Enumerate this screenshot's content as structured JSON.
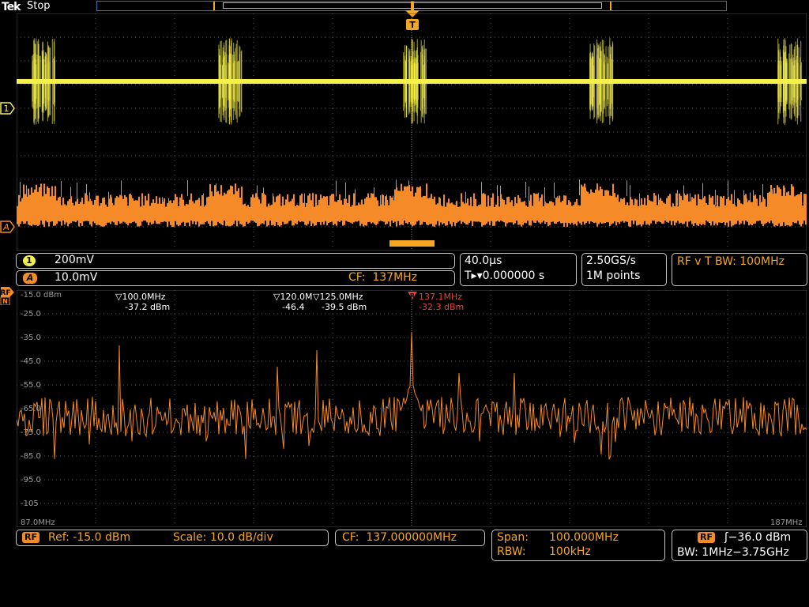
{
  "top": {
    "brand": "Tek",
    "run_state": "Stop",
    "trigger_marker": "T"
  },
  "channels": {
    "ch1_marker": "1",
    "chA_marker": "A",
    "rf_marker": "RF",
    "rf_sub": "N"
  },
  "readouts": {
    "ch1_badge": "1",
    "ch1_scale": "200mV",
    "chA_badge": "A",
    "chA_scale": "10.0mV",
    "chA_cf": "CF:  137MHz",
    "horiz_scale": "40.0µs",
    "trigger_pos": "T▸▾0.000000 s",
    "sample_rate": "2.50GS/s",
    "record_length": "1M points",
    "rf_v_t": "RF v T BW: 100MHz"
  },
  "spectrum": {
    "y_labels": [
      "-15.0 dBm",
      "-25.0",
      "-35.0",
      "-45.0",
      "-55.0",
      "-65.0",
      "-75.0",
      "-85.0",
      "-95.0",
      "-105"
    ],
    "x_start": "87.0MHz",
    "x_end": "187MHz",
    "markers": [
      {
        "freq": "▽100.0MHz",
        "level": "-37.2 dBm"
      },
      {
        "freq": "▽120.0M",
        "level": "-46.4"
      },
      {
        "freq": "▽125.0MHz",
        "level": "-39.5 dBm"
      },
      {
        "freq": "137.1MHz",
        "level": "-32.3 dBm",
        "ref": "R"
      }
    ]
  },
  "bottom": {
    "rf_badge": "RF",
    "ref": "Ref: -15.0 dBm",
    "scale": "Scale: 10.0 dB/div",
    "cf": "CF:  137.000000MHz",
    "span_label": "Span:",
    "span_value": "100.000MHz",
    "rbw_label": "RBW:",
    "rbw_value": "100kHz",
    "trig_badge": "RF",
    "trig_level": "ʃ−36.0 dBm",
    "bw": "BW: 1MHz−3.75GHz"
  },
  "colors": {
    "ch1": "#f5f04a",
    "rf": "#f58a29",
    "ref_marker": "#e0453a",
    "grid": "#5a5a5a"
  },
  "icons": [
    "trigger-position-icon",
    "ch1-marker-icon",
    "math-a-marker-icon",
    "rf-marker-icon",
    "ref-marker-icon",
    "trigger-slope-icon"
  ]
}
